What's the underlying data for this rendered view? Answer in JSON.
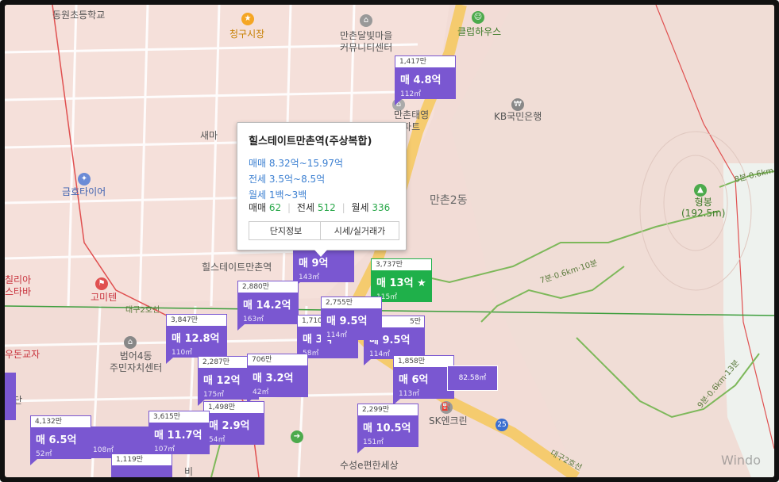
{
  "map": {
    "place_labels": [
      {
        "name": "school",
        "text": "동원초등학교"
      },
      {
        "name": "market",
        "text": "청구시장"
      },
      {
        "name": "community-center",
        "text": "만촌달빛마을\n커뮤니티센터"
      },
      {
        "name": "club-house",
        "text": "클럽하우스"
      },
      {
        "name": "kb-bank",
        "text": "KB국민은행"
      },
      {
        "name": "apt-manchon-taeyoung",
        "text": "만촌태영\n아파트"
      },
      {
        "name": "sae",
        "text": "새마"
      },
      {
        "name": "tire-shop",
        "text": "금호타이어"
      },
      {
        "name": "manchon2dong",
        "text": "만촌2동"
      },
      {
        "name": "hyeongbong",
        "text": "형봉\n(192.5m)"
      },
      {
        "name": "hillstate-building",
        "text": "힐스테이트만촌역"
      },
      {
        "name": "cilia",
        "text": "칠리아\n스타바"
      },
      {
        "name": "gomiten",
        "text": "고미텐"
      },
      {
        "name": "dongguk-road",
        "text": "대구2호선"
      },
      {
        "name": "dongguk-road-2",
        "text": "대구2호선"
      },
      {
        "name": "ramen",
        "text": "우돈교자"
      },
      {
        "name": "bumeo4dong",
        "text": "범어4동\n주민자치센터"
      },
      {
        "name": "sk-encrean",
        "text": "SK엔크린"
      },
      {
        "name": "suseong-e",
        "text": "수성e편한세상"
      },
      {
        "name": "route-25",
        "text": "25"
      },
      {
        "name": "trail-1",
        "text": "7분·0.6km·10분"
      },
      {
        "name": "trail-2",
        "text": "9분·0.6km·13분"
      },
      {
        "name": "trail-3",
        "text": "8분·0.6km"
      },
      {
        "name": "sindan",
        "text": "신단"
      },
      {
        "name": "bi",
        "text": "비"
      }
    ]
  },
  "listings": [
    {
      "id": "l1",
      "price_top": "1,417만",
      "price": "매 4.8억",
      "area": "112㎡"
    },
    {
      "id": "l2",
      "price_top": "",
      "price": "매 9억",
      "area": "143㎡"
    },
    {
      "id": "l3",
      "price_top": "3,737만",
      "price": "매 13억 ★",
      "area": "115㎡",
      "highlight": true
    },
    {
      "id": "l4",
      "price_top": "2,880만",
      "price": "매 14.2억",
      "area": "163㎡"
    },
    {
      "id": "l5",
      "price_top": "3,847만",
      "price": "매 12.8억",
      "area": "110㎡"
    },
    {
      "id": "l6",
      "price_top": "1,710만",
      "price": "매 3억",
      "area": "58㎡"
    },
    {
      "id": "l7",
      "price_top": "2,755만",
      "price": "매 9.5억",
      "area": "114㎡"
    },
    {
      "id": "l8",
      "price_top": "5만",
      "price": "매 9.5억",
      "area": "114㎡"
    },
    {
      "id": "l9",
      "price_top": "2,287만",
      "price": "매 12억",
      "area": "175㎡"
    },
    {
      "id": "l10",
      "price_top": "706만",
      "price": "매 3.2억",
      "area": "42㎡"
    },
    {
      "id": "l11",
      "price_top": "1,858만",
      "price": "매 6억",
      "area": "113㎡"
    },
    {
      "id": "l12",
      "price_top": "1,498만",
      "price": "매 2.9억",
      "area": "54㎡"
    },
    {
      "id": "l13",
      "price_top": "3,615만",
      "price": "매 11.7억",
      "area": "107㎡"
    },
    {
      "id": "l14",
      "price_top": "2,299만",
      "price": "매 10.5억",
      "area": "151㎡"
    },
    {
      "id": "l15",
      "price_top": "4,132만",
      "price": "매 6.5억",
      "area": "52㎡"
    },
    {
      "id": "l16",
      "price_top": "",
      "price": "",
      "area": "108㎡"
    },
    {
      "id": "l17",
      "price_top": "1,119만",
      "price": "",
      "area": ""
    }
  ],
  "popup": {
    "title": "힐스테이트만촌역(주상복합)",
    "sale": "매매 8.32억~15.97억",
    "jeonse": "전세 3.5억~8.5억",
    "monthly": "월세 1백~3백",
    "count_sale_label": "매매",
    "count_sale": "62",
    "count_jeonse_label": "전세",
    "count_jeonse": "512",
    "count_monthly_label": "월세",
    "count_monthly": "336",
    "btn_info": "단지정보",
    "btn_price": "시세/실거래가"
  },
  "selected_small": {
    "text": "82.58㎡"
  },
  "watermark": "Windo",
  "colors": {
    "marker": "#7a57d1",
    "marker_highlight": "#1fb04a",
    "road": "#f6c85c",
    "land": "#f2dcd6"
  }
}
